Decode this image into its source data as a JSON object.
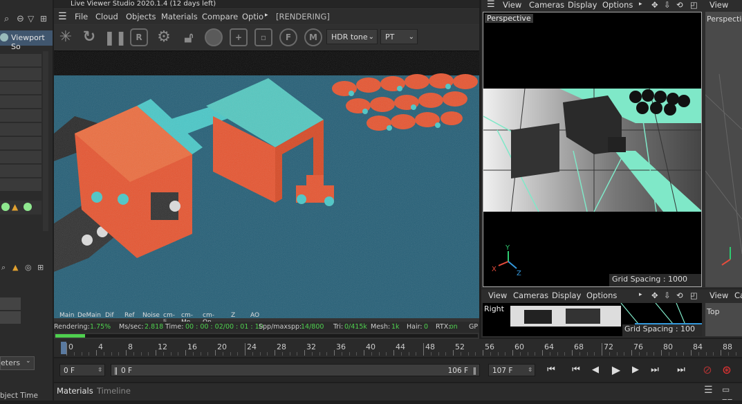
{
  "left_panel": {
    "viewport_solo_label": "Viewport So",
    "meters_label": "eters",
    "object_time_label": "bject Time"
  },
  "live_viewer": {
    "title": "Live Viewer Studio 2020.1.4 (12 days left)",
    "menu": [
      "File",
      "Cloud",
      "Objects",
      "Materials",
      "Compare",
      "Optio"
    ],
    "status": "[RENDERING]",
    "tools": [
      "R",
      "F",
      "M"
    ],
    "tone_mapping": "HDR tone",
    "kernel": "PT",
    "aov_tabs": [
      "Main",
      "DeMain",
      "Dif",
      "Ref",
      "Noise",
      "cm-li",
      "cm-Mn",
      "cm-On",
      "Z",
      "AO"
    ],
    "stats": {
      "rendering_label": "Rendering:",
      "rendering_value": "1.75%",
      "ms_label": "Ms/sec:",
      "ms_value": "2.818",
      "time_label": "Time:",
      "time_value": "00 : 00 : 02/00 : 01 : 10",
      "spp_label": "Spp/maxspp:",
      "spp_value": "14/800",
      "tri_label": "Tri:",
      "tri_value": "0/415k",
      "mesh_label": "Mesh:",
      "mesh_value": "1k",
      "hair_label": "Hair:",
      "hair_value": "0",
      "rtx_label": "RTX:",
      "rtx_value": "on",
      "gpu_label": "GP"
    },
    "progress": 0.0175
  },
  "viewport_main": {
    "menu": [
      "View",
      "Cameras",
      "Display",
      "Options"
    ],
    "label": "Perspective",
    "grid_spacing": "Grid Spacing : 1000 cm",
    "axes": {
      "y": "Y",
      "x": "X",
      "z": "Z"
    }
  },
  "viewport_right": {
    "menu": [
      "View"
    ],
    "label": "Perspecti"
  },
  "viewport_bottom": {
    "menu": [
      "View",
      "Cameras",
      "Display",
      "Options"
    ],
    "label": "Right",
    "grid_spacing": "Grid Spacing : 100 cm"
  },
  "viewport_bottom_right": {
    "menu": [
      "View",
      "Ca"
    ],
    "label": "Top"
  },
  "timeline": {
    "ticks": [
      "0",
      "4",
      "8",
      "12",
      "16",
      "20",
      "24",
      "28",
      "32",
      "36",
      "40",
      "44",
      "48",
      "52",
      "56",
      "60",
      "64",
      "68",
      "72",
      "76",
      "80",
      "84",
      "88"
    ],
    "current_frame": "0 F",
    "range_start": "0 F",
    "range_end": "106 F",
    "max_frame": "107 F"
  },
  "bottom_tabs": [
    "Materials",
    "Timeline"
  ],
  "colors": {
    "accent_green": "#4fd04f",
    "render_blue": "#1d5a73",
    "orange": "#e8502a",
    "cyan": "#44c8c8",
    "mint": "#7fe8c8"
  }
}
